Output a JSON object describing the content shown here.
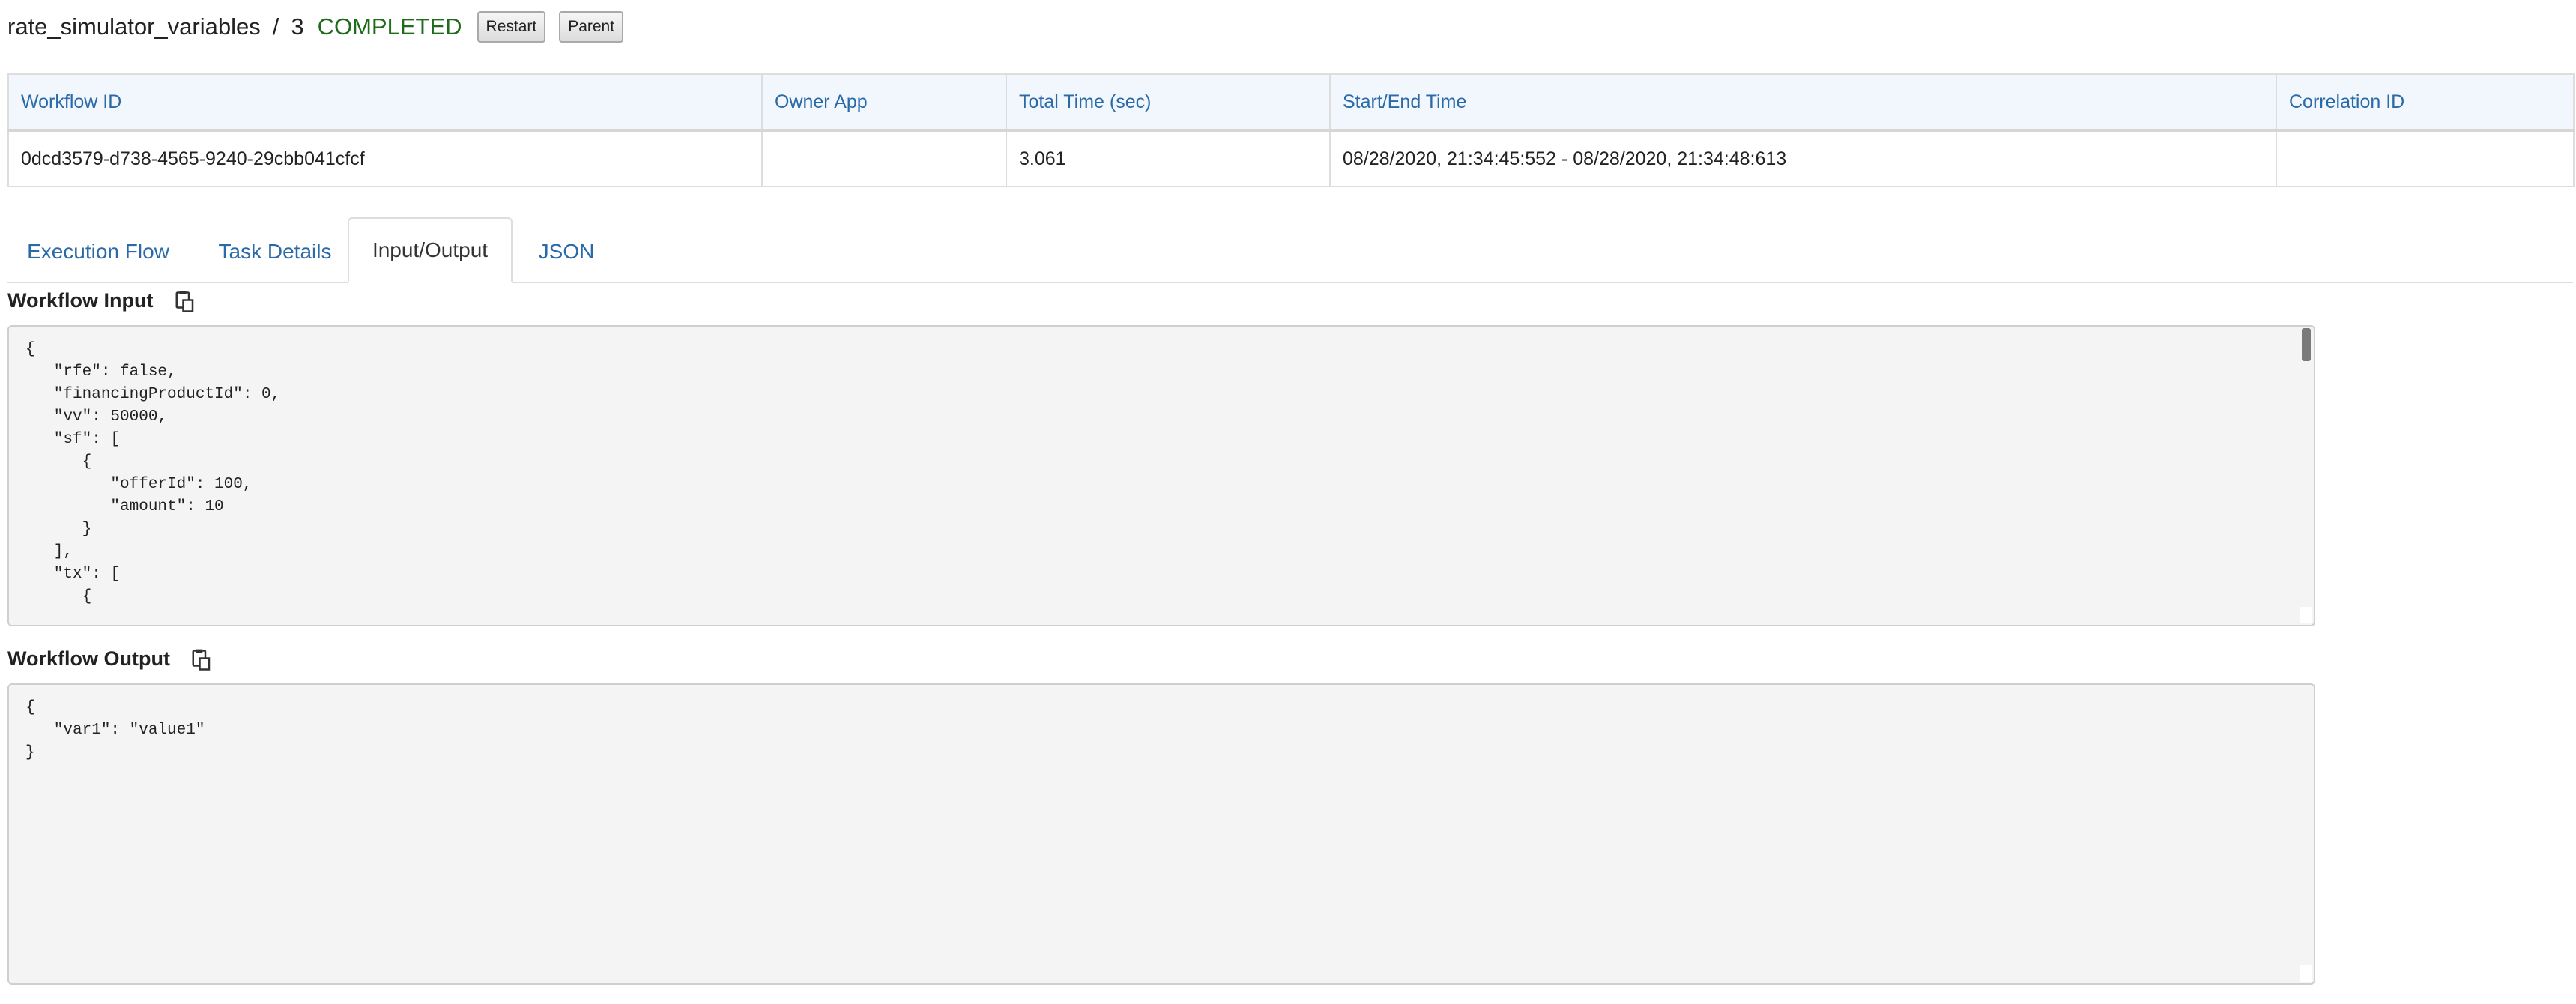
{
  "header": {
    "workflow_name": "rate_simulator_variables",
    "separator": "/",
    "version": "3",
    "status": "COMPLETED",
    "restart_label": "Restart",
    "parent_label": "Parent"
  },
  "summary": {
    "columns": [
      "Workflow ID",
      "Owner App",
      "Total Time (sec)",
      "Start/End Time",
      "Correlation ID"
    ],
    "row": {
      "workflow_id": "0dcd3579-d738-4565-9240-29cbb041cfcf",
      "owner_app": "",
      "total_time": "3.061",
      "start_end_time": "08/28/2020, 21:34:45:552 - 08/28/2020, 21:34:48:613",
      "correlation_id": ""
    }
  },
  "tabs": [
    {
      "label": "Execution Flow",
      "active": false
    },
    {
      "label": "Task Details",
      "active": false
    },
    {
      "label": "Input/Output",
      "active": true
    },
    {
      "label": "JSON",
      "active": false
    }
  ],
  "workflow_input": {
    "title": "Workflow Input",
    "content": "{\n   \"rfe\": false,\n   \"financingProductId\": 0,\n   \"vv\": 50000,\n   \"sf\": [\n      {\n         \"offerId\": 100,\n         \"amount\": 10\n      }\n   ],\n   \"tx\": [\n      {"
  },
  "workflow_output": {
    "title": "Workflow Output",
    "content": "{\n   \"var1\": \"value1\"\n}"
  },
  "icons": {
    "copy": "clipboard-copy-icon"
  },
  "colors": {
    "link_blue": "#2a6aa8",
    "status_green": "#1e6b1e",
    "header_bg": "#f1f7fc",
    "code_bg": "#f4f4f4"
  }
}
